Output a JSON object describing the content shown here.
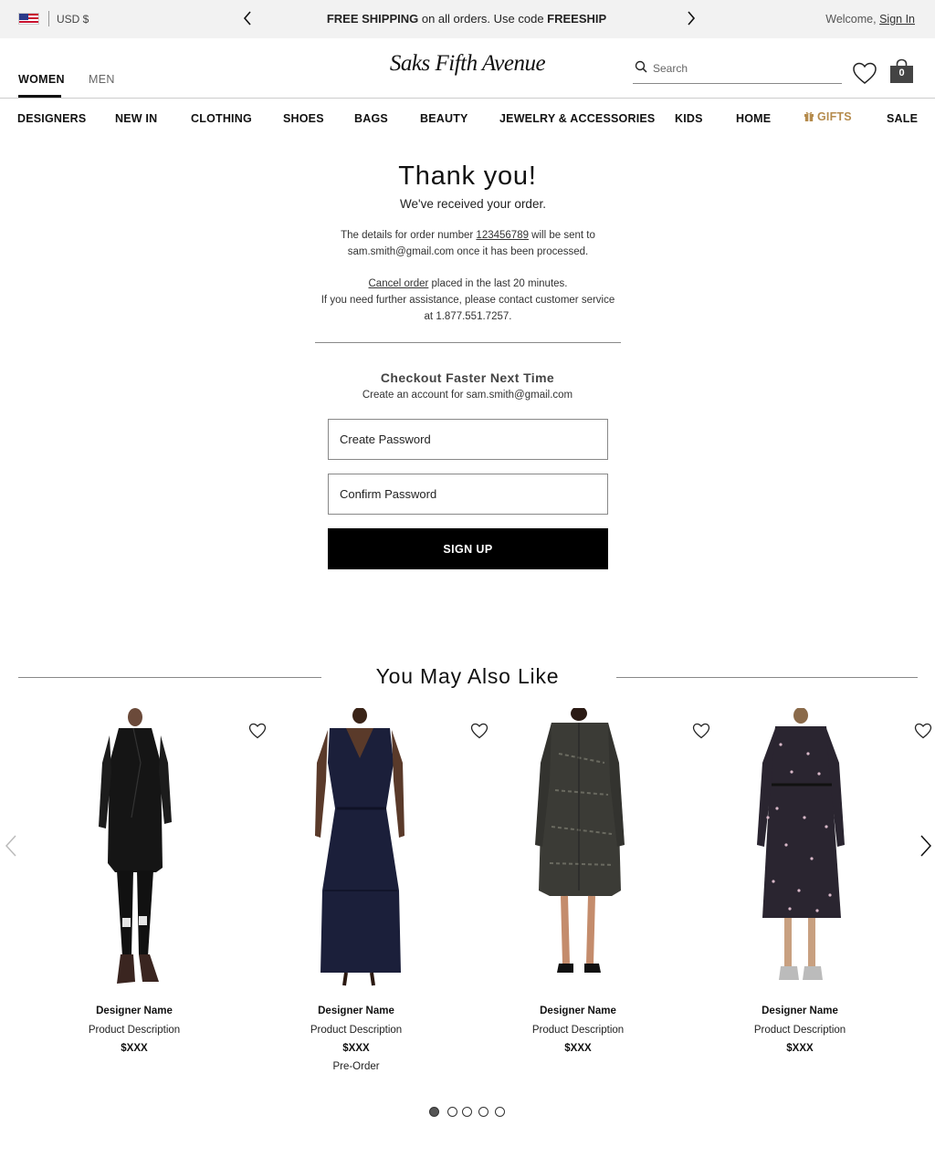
{
  "promo_bar": {
    "currency": "USD $",
    "message_bold_1": "FREE SHIPPING",
    "message_middle": " on all orders. Use code ",
    "message_bold_2": "FREESHIP",
    "welcome": "Welcome, ",
    "sign_in": "Sign In"
  },
  "header": {
    "gender_tabs": [
      "WOMEN",
      "MEN"
    ],
    "logo": "Saks Fifth Avenue",
    "search_placeholder": "Search",
    "bag_count": "0"
  },
  "nav": {
    "items": [
      "DESIGNERS",
      "NEW IN",
      "CLOTHING",
      "SHOES",
      "BAGS",
      "BEAUTY",
      "JEWELRY & ACCESSORIES",
      "KIDS",
      "HOME",
      "GIFTS",
      "SALE"
    ]
  },
  "confirmation": {
    "title": "Thank you!",
    "subtitle": "We've received your order.",
    "details_prefix": "The details for order number ",
    "order_number": "123456789",
    "details_suffix": " will be sent to",
    "details_line2": "sam.smith@gmail.com once it has been processed.",
    "cancel_link": "Cancel order",
    "cancel_suffix": " placed in the last 20 minutes.",
    "help_line1": "If you need further assistance, please contact customer service",
    "help_line2": "at 1.877.551.7257."
  },
  "checkout": {
    "title": "Checkout Faster Next Time",
    "subtitle": "Create an account for sam.smith@gmail.com",
    "password_placeholder": "Create Password",
    "confirm_placeholder": "Confirm Password",
    "signup_label": "SIGN UP"
  },
  "recommendations": {
    "title": "You May Also Like",
    "products": [
      {
        "designer": "Designer Name",
        "description": "Product Description",
        "price": "$XXX",
        "badge": ""
      },
      {
        "designer": "Designer Name",
        "description": "Product Description",
        "price": "$XXX",
        "badge": "Pre-Order"
      },
      {
        "designer": "Designer Name",
        "description": "Product Description",
        "price": "$XXX",
        "badge": ""
      },
      {
        "designer": "Designer Name",
        "description": "Product Description",
        "price": "$XXX",
        "badge": ""
      }
    ],
    "page_count": 5,
    "active_page": 1
  },
  "colors": {
    "gifts_accent": "#b58b4c",
    "promo_bg": "#f2f2f2",
    "button_bg": "#000000"
  },
  "icons": [
    "us-flag-icon",
    "chevron-left-icon",
    "chevron-right-icon",
    "search-icon",
    "heart-icon",
    "shopping-bag-icon",
    "gift-icon"
  ]
}
